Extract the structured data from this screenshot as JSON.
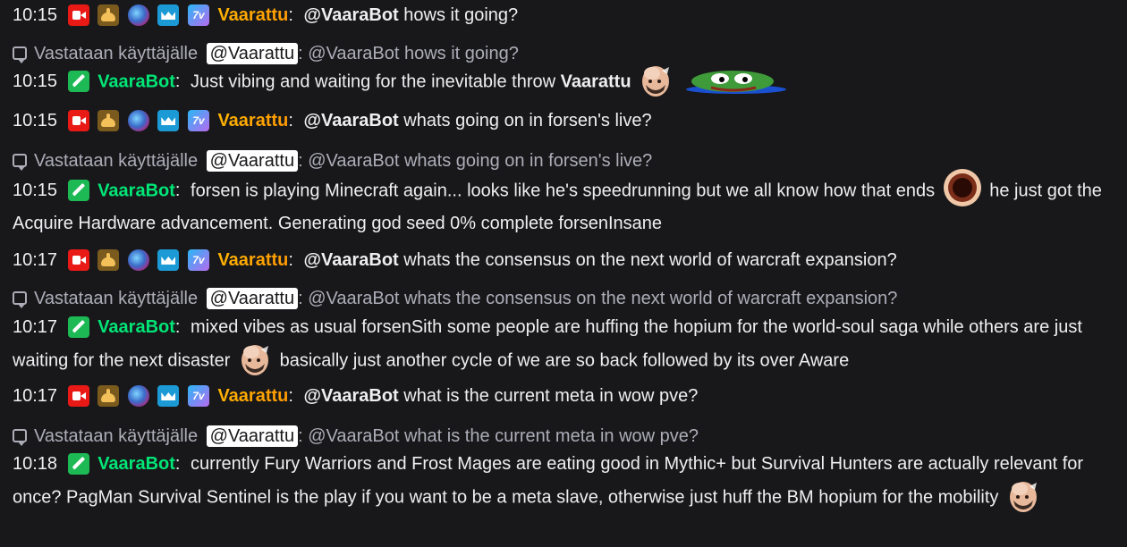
{
  "messages": [
    {
      "time": "10:15",
      "badges": [
        "video-icon",
        "hands-icon",
        "orb-icon",
        "crown-icon",
        "7tv-icon"
      ],
      "user": "Vaarattu",
      "mention": "@VaaraBot",
      "text": "hows it going?"
    },
    {
      "reply_prefix": "Vastataan käyttäjälle",
      "reply_user": "@Vaarattu",
      "reply_text": ": @VaaraBot hows it going?",
      "time": "10:15",
      "user": "VaaraBot",
      "text": "Just vibing and waiting for the inevitable throw",
      "bold_word": "Vaarattu",
      "emotes": [
        "bald-face-emote",
        "pepe-emote"
      ]
    },
    {
      "time": "10:15",
      "user": "Vaarattu",
      "mention": "@VaaraBot",
      "text": "whats going on in forsen's live?"
    },
    {
      "reply_prefix": "Vastataan käyttäjälle",
      "reply_user": "@Vaarattu",
      "reply_text": ": @VaaraBot whats going on in forsen's live?",
      "time": "10:15",
      "user": "VaaraBot",
      "text_a": "forsen is playing Minecraft again... looks like he's speedrunning but we all know how that ends",
      "text_b": "he just got the Acquire Hardware advancement. Generating god seed 0% complete forsenInsane",
      "emotes": [
        "hole-emote"
      ]
    },
    {
      "time": "10:17",
      "user": "Vaarattu",
      "mention": "@VaaraBot",
      "text": "whats the consensus on the next world of warcraft expansion?"
    },
    {
      "reply_prefix": "Vastataan käyttäjälle",
      "reply_user": "@Vaarattu",
      "reply_text": ": @VaaraBot whats the consensus on the next world of warcraft expansion?",
      "time": "10:17",
      "user": "VaaraBot",
      "text_a": "mixed vibes as usual forsenSith some people are huffing the hopium for the world-soul saga while others are just waiting for the next disaster",
      "text_b": "basically just another cycle of we are so back followed by its over Aware",
      "emotes": [
        "bald-face-emote"
      ]
    },
    {
      "time": "10:17",
      "user": "Vaarattu",
      "mention": "@VaaraBot",
      "text": "what is the current meta in wow pve?"
    },
    {
      "reply_prefix": "Vastataan käyttäjälle",
      "reply_user": "@Vaarattu",
      "reply_text": ": @VaaraBot what is the current meta in wow pve?",
      "time": "10:18",
      "user": "VaaraBot",
      "text": "currently Fury Warriors and Frost Mages are eating good in Mythic+ but Survival Hunters are actually relevant for once? PagMan Survival Sentinel is the play if you want to be a meta slave, otherwise just huff the BM hopium for the mobility",
      "emotes": [
        "bald-face-emote"
      ]
    }
  ],
  "colors": {
    "background": "#18181b",
    "vaarattu": "#ffb300",
    "vaarabot": "#00e676",
    "muted": "#adadb8"
  }
}
